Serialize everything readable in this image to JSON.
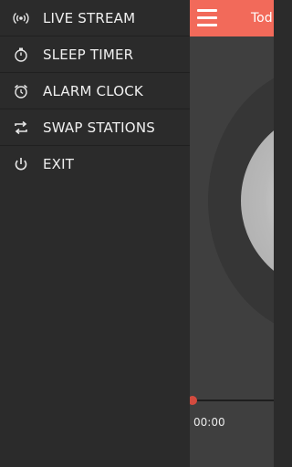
{
  "drawer": {
    "items": [
      {
        "label": "LIVE STREAM",
        "icon": "radio-waves-icon"
      },
      {
        "label": "SLEEP TIMER",
        "icon": "stopwatch-icon"
      },
      {
        "label": "ALARM CLOCK",
        "icon": "alarm-clock-icon"
      },
      {
        "label": "SWAP STATIONS",
        "icon": "swap-arrows-icon"
      },
      {
        "label": "EXIT",
        "icon": "power-icon"
      }
    ]
  },
  "header": {
    "title": "Tod",
    "accent": "#f26a5a"
  },
  "player": {
    "elapsed": "00:00",
    "progress_accent": "#d34b3f"
  }
}
